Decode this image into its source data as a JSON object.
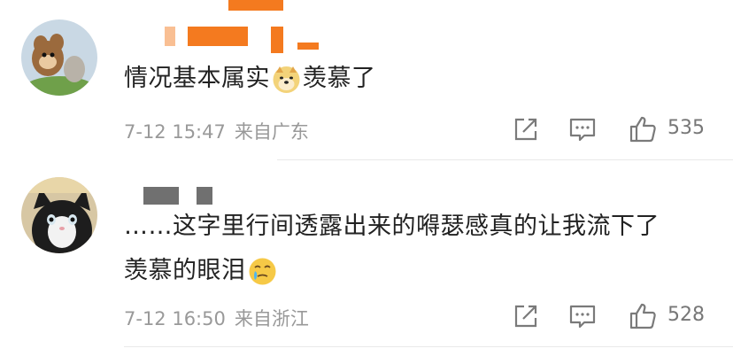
{
  "comments": [
    {
      "text": "情况基本属实",
      "text_after_emoji": "羡慕了",
      "emoji": "doge-emoji",
      "date": "7-12 15:47",
      "location": "来自广东",
      "likes": "535"
    },
    {
      "text_line1": "……这字里行间透露出来的嘚瑟感真的让我流下了",
      "text_line2": "羡慕的眼泪",
      "emoji": "tearful-smile-emoji",
      "date": "7-12 16:50",
      "location": "来自浙江",
      "likes": "528"
    }
  ],
  "icons": {
    "share": "share-icon",
    "reply": "comment-icon",
    "like": "thumbs-up-icon"
  },
  "colors": {
    "username_blur": "#f47a1f",
    "username_blur_2": "#707070",
    "meta_text": "#999999"
  }
}
